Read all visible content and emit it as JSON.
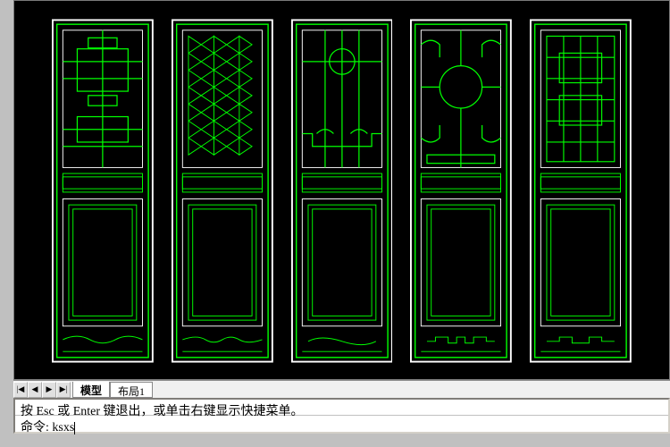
{
  "cad": {
    "stroke_white": "#ffffff",
    "stroke_green": "#00ff00",
    "bg": "#000000"
  },
  "tabs": {
    "active": "模型",
    "layout1": "布局1"
  },
  "nav": {
    "first": "|◀",
    "prev": "◀",
    "next": "▶",
    "last": "▶|"
  },
  "command": {
    "hint": "按 Esc 或 Enter 键退出，或单击右键显示快捷菜单。",
    "prompt": "命令: ",
    "input": "ksxs"
  }
}
